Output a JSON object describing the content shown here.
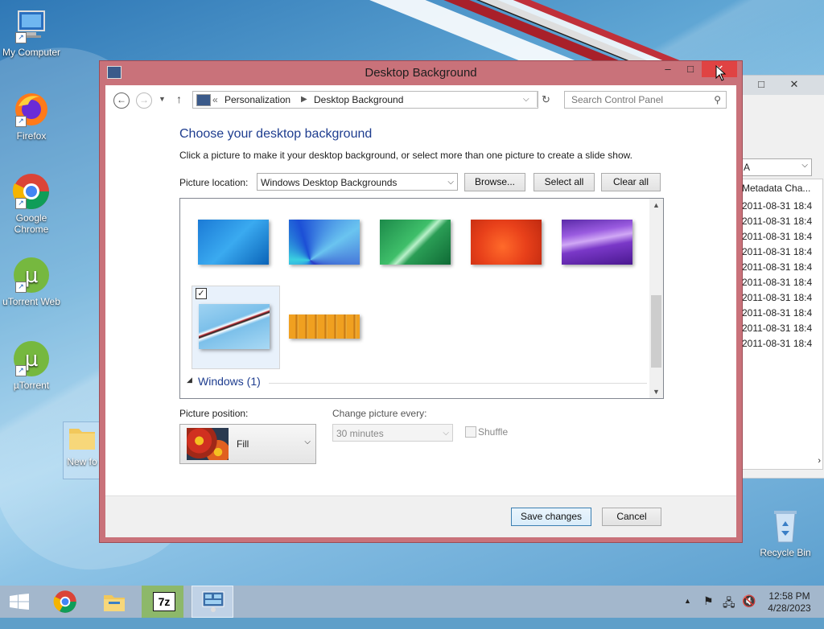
{
  "desktop": {
    "icons": [
      {
        "label": "My Computer"
      },
      {
        "label": "Firefox"
      },
      {
        "label": "Google Chrome"
      },
      {
        "label": "uTorrent Web"
      },
      {
        "label": "µTorrent"
      },
      {
        "label": "New fo"
      },
      {
        "label": "Recycle Bin"
      }
    ]
  },
  "back_window": {
    "combo_text": "A",
    "column_header": "Metadata Cha...",
    "rows": [
      "2011-08-31 18:4",
      "2011-08-31 18:4",
      "2011-08-31 18:4",
      "2011-08-31 18:4",
      "2011-08-31 18:4",
      "2011-08-31 18:4",
      "2011-08-31 18:4",
      "2011-08-31 18:4",
      "2011-08-31 18:4",
      "2011-08-31 18:4"
    ]
  },
  "dialog": {
    "title": "Desktop Background",
    "breadcrumb": {
      "sep": "«",
      "items": [
        "Personalization",
        "Desktop Background"
      ]
    },
    "search_placeholder": "Search Control Panel",
    "heading": "Choose your desktop background",
    "description": "Click a picture to make it your desktop background, or select more than one picture to create a slide show.",
    "picture_location_label": "Picture location:",
    "picture_location_value": "Windows Desktop Backgrounds",
    "browse_label": "Browse...",
    "select_all_label": "Select all",
    "clear_all_label": "Clear all",
    "group_label": "Windows (1)",
    "picture_position_label": "Picture position:",
    "picture_position_value": "Fill",
    "change_picture_label": "Change picture every:",
    "change_picture_value": "30 minutes",
    "shuffle_label": "Shuffle",
    "save_label": "Save changes",
    "cancel_label": "Cancel"
  },
  "taskbar": {
    "time": "12:58 PM",
    "date": "4/28/2023"
  },
  "colors": {
    "dialog_frame": "#c9727a",
    "close_button": "#e04343",
    "heading": "#1e3d8f",
    "taskbar": "#a3b7cc"
  }
}
